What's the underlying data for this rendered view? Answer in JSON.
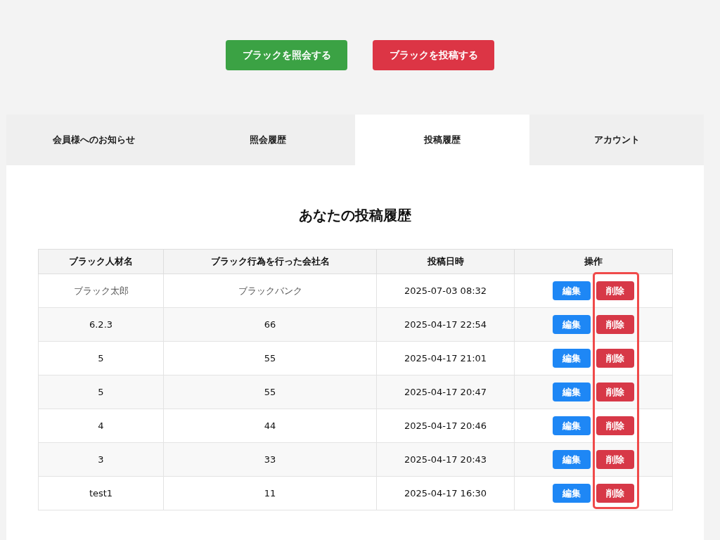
{
  "actions": [
    {
      "label": "ブラックを照会する",
      "kind": "search"
    },
    {
      "label": "ブラックを投稿する",
      "kind": "post"
    }
  ],
  "tabs": [
    {
      "label": "会員様へのお知らせ",
      "selected": false
    },
    {
      "label": "照会履歴",
      "selected": false
    },
    {
      "label": "投稿履歴",
      "selected": true
    },
    {
      "label": "アカウント",
      "selected": false
    }
  ],
  "heading": "あなたの投稿履歴",
  "table": {
    "columns": [
      "ブラック人材名",
      "ブラック行為を行った会社名",
      "投稿日時",
      "操作"
    ],
    "rows": [
      {
        "name": "ブラック太郎",
        "company": "ブラックバンク",
        "date": "2025-07-03 08:32",
        "muted": true,
        "edit": "編集",
        "delete": "削除"
      },
      {
        "name": "6.2.3",
        "company": "66",
        "date": "2025-04-17 22:54",
        "muted": false,
        "edit": "編集",
        "delete": "削除"
      },
      {
        "name": "5",
        "company": "55",
        "date": "2025-04-17 21:01",
        "muted": false,
        "edit": "編集",
        "delete": "削除"
      },
      {
        "name": "5",
        "company": "55",
        "date": "2025-04-17 20:47",
        "muted": false,
        "edit": "編集",
        "delete": "削除"
      },
      {
        "name": "4",
        "company": "44",
        "date": "2025-04-17 20:46",
        "muted": false,
        "edit": "編集",
        "delete": "削除"
      },
      {
        "name": "3",
        "company": "33",
        "date": "2025-04-17 20:43",
        "muted": false,
        "edit": "編集",
        "delete": "削除"
      },
      {
        "name": "test1",
        "company": "11",
        "date": "2025-04-17 16:30",
        "muted": false,
        "edit": "編集",
        "delete": "削除"
      }
    ]
  },
  "delete_column_highlighted": true
}
